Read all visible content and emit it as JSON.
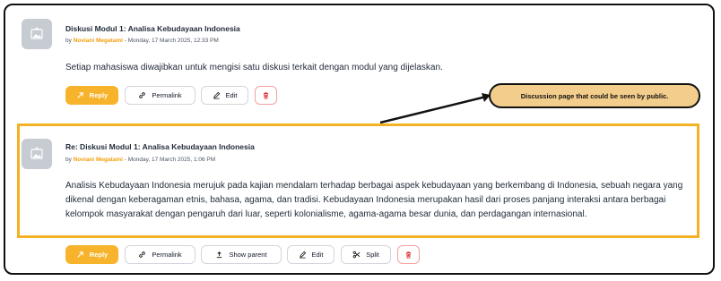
{
  "posts": [
    {
      "title": "Diskusi Modul 1: Analisa Kebudayaan Indonesia",
      "by": "by",
      "author": "Noviani Megatami",
      "date": " - Monday, 17 March 2025, 12:33 PM",
      "body": "Setiap mahasiswa diwajibkan untuk mengisi satu diskusi terkait dengan modul yang dijelaskan.",
      "actions": [
        "Reply",
        "Permalink",
        "Edit"
      ]
    },
    {
      "title": "Re: Diskusi Modul 1: Analisa Kebudayaan Indonesia",
      "by": "by",
      "author": "Noviani Megatami",
      "date": " - Monday, 17 March 2025, 1:06 PM",
      "body": "Analisis Kebudayaan Indonesia merujuk pada kajian mendalam terhadap berbagai aspek kebudayaan yang berkembang di Indonesia, sebuah negara yang dikenal dengan keberagaman etnis, bahasa, agama, dan tradisi. Kebudayaan Indonesia merupakan hasil dari proses panjang interaksi antara berbagai kelompok masyarakat dengan pengaruh dari luar, seperti kolonialisme, agama-agama besar dunia, dan perdagangan internasional.",
      "actions": [
        "Reply",
        "Permalink",
        "Show parent",
        "Edit",
        "Split"
      ]
    }
  ],
  "annotation": {
    "callout": "Discussion page that could be seen by public.",
    "highlight_color": "#f4b124",
    "callout_color": "#f3cd8b"
  },
  "colors": {
    "accent": "#f7b32b",
    "author": "#f59e0b",
    "delete": "#dc2626"
  },
  "icons": [
    "image-placeholder-icon",
    "reply-icon",
    "link-icon",
    "edit-icon",
    "trash-icon",
    "upload-icon",
    "scissors-icon"
  ]
}
